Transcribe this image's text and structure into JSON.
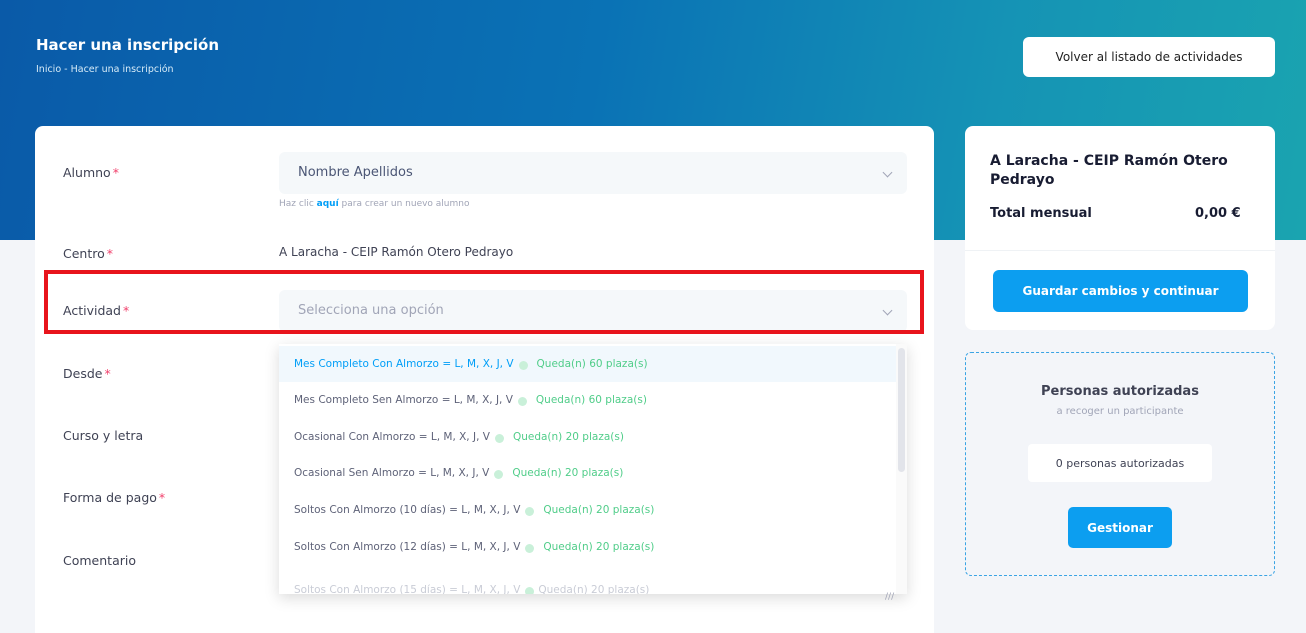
{
  "header": {
    "title": "Hacer una inscripción",
    "breadcrumb": "Inicio - Hacer una inscripción",
    "back_button": "Volver al listado de actividades"
  },
  "form": {
    "alumno": {
      "label": "Alumno",
      "required": "*",
      "value": "Nombre Apellidos",
      "hint_prefix": "Haz clic ",
      "hint_link": "aquí",
      "hint_suffix": " para crear un nuevo alumno"
    },
    "centro": {
      "label": "Centro",
      "required": "*",
      "value": "A Laracha - CEIP Ramón Otero Pedrayo"
    },
    "actividad": {
      "label": "Actividad",
      "required": "*",
      "placeholder": "Selecciona una opción",
      "options": [
        {
          "label": "Mes Completo Con Almorzo = L, M, X, J, V",
          "availability": "Queda(n) 60 plaza(s)"
        },
        {
          "label": "Mes Completo Sen Almorzo = L, M, X, J, V",
          "availability": "Queda(n) 60 plaza(s)"
        },
        {
          "label": "Ocasional Con Almorzo = L, M, X, J, V",
          "availability": "Queda(n) 20 plaza(s)"
        },
        {
          "label": "Ocasional Sen Almorzo = L, M, X, J, V",
          "availability": "Queda(n) 20 plaza(s)"
        },
        {
          "label": "Soltos Con Almorzo (10 días) = L, M, X, J, V",
          "availability": "Queda(n) 20 plaza(s)"
        },
        {
          "label": "Soltos Con Almorzo (12 días) = L, M, X, J, V",
          "availability": "Queda(n) 20 plaza(s)"
        },
        {
          "label": "Soltos Con Almorzo (15 días) = L, M, X, J, V",
          "availability": "Queda(n) 20 plaza(s)"
        }
      ]
    },
    "desde": {
      "label": "Desde",
      "required": "*"
    },
    "curso": {
      "label": "Curso y letra"
    },
    "forma_pago": {
      "label": "Forma de pago",
      "required": "*"
    },
    "comentario": {
      "label": "Comentario"
    }
  },
  "summary": {
    "center_name": "A Laracha - CEIP Ramón Otero Pedrayo",
    "total_label": "Total mensual",
    "total_value": "0,00 €",
    "save_button": "Guardar cambios y continuar"
  },
  "authorized": {
    "title": "Personas autorizadas",
    "subtitle": "a recoger un participante",
    "count": "0 personas autorizadas",
    "manage_button": "Gestionar"
  },
  "colors": {
    "accent": "#009ef7",
    "required": "#f1416c",
    "success": "#50cd89",
    "highlight": "#e8141c"
  }
}
